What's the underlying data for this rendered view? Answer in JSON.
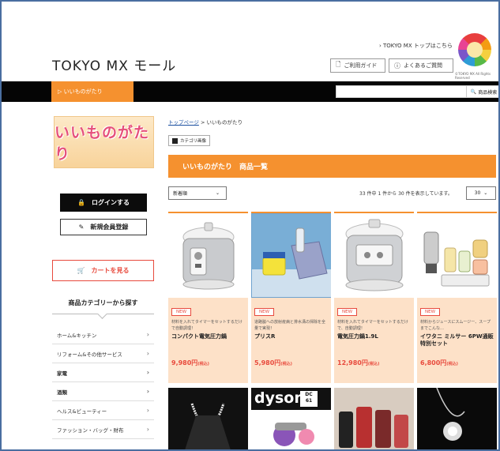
{
  "header": {
    "logo_text": "TOKYO MX モール",
    "top_link": "› TOKYO MX トップはこちら",
    "guide_label": "ご利用ガイド",
    "faq_label": "よくあるご質問",
    "copyright": "©TOKYO MX All Rights Reserved"
  },
  "nav": {
    "active_tab": "▷ いいものがたり",
    "search_label": "商品検索"
  },
  "sidebar": {
    "banner_text": "いいものがたり",
    "login_label": "ログインする",
    "register_label": "新規会員登録",
    "cart_label": "カートを見る",
    "category_heading": "商品カテゴリーから探す",
    "categories": [
      {
        "label": "ホーム&キッチン",
        "bold": false
      },
      {
        "label": "リフォーム&その他サービス",
        "bold": false
      },
      {
        "label": "家電",
        "bold": true
      },
      {
        "label": "酒類",
        "bold": true
      },
      {
        "label": "ヘルス&ビューティー",
        "bold": false
      },
      {
        "label": "ファッション・バッグ・財布",
        "bold": false
      }
    ]
  },
  "main": {
    "breadcrumb_home": "トップページ",
    "breadcrumb_sep": " > ",
    "breadcrumb_current": "いいものがたり",
    "category_image_label": "カテゴリ画像",
    "title": "いいものがたり　商品一覧",
    "sort_value": "新着順",
    "count_text": "33 件中 1 件から 30 件を表示しています。",
    "per_page_value": "30",
    "products": [
      {
        "badge": "NEW",
        "desc": "材料を入れてタイマーをセットするだけで自動調理！",
        "name": "コンパクト電気圧力鍋",
        "price": "9,980円",
        "tax": "(税込)"
      },
      {
        "badge": "NEW",
        "desc": "道路脇への放射疫病と排水溝の掃除を全量で実現！",
        "name": "プリスR",
        "price": "5,980円",
        "tax": "(税込)"
      },
      {
        "badge": "NEW",
        "desc": "材料を入れてタイマーをセットするだけで、自動調理！",
        "name": "電気圧力鍋1.9L",
        "price": "12,980円",
        "tax": "(税込)"
      },
      {
        "badge": "NEW",
        "desc": "材料からジュースにスムージー、スープまでこんな…",
        "name": "イワタニ ミルサー 6PW通販特別セット",
        "price": "6,800円",
        "tax": "(税込)"
      }
    ],
    "second_row_dyson_text": "dyson",
    "second_row_dyson_badge": "DC 61"
  },
  "colors": {
    "accent_orange": "#f5912f",
    "price_red": "#e84a3d",
    "card_bg": "#fde1c8",
    "nav_black": "#050505"
  }
}
